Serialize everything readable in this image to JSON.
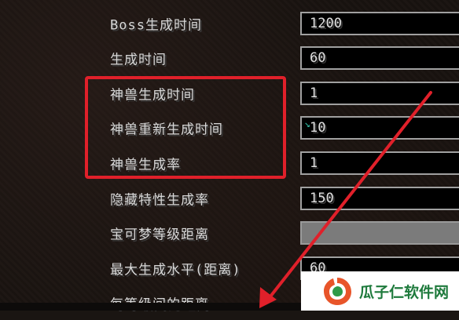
{
  "settings": [
    {
      "label": "Boss生成时间",
      "value": "1200"
    },
    {
      "label": "生成时间",
      "value": "60"
    },
    {
      "label": "神兽生成时间",
      "value": "1"
    },
    {
      "label": "神兽重新生成时间",
      "value": "10"
    },
    {
      "label": "神兽生成率",
      "value": "1"
    },
    {
      "label": "隐藏特性生成率",
      "value": "150"
    },
    {
      "label": "宝可梦等级距离",
      "value": ""
    },
    {
      "label": "最大生成水平(距离)",
      "value": "60"
    },
    {
      "label": "每等级间的距离",
      "value": ""
    }
  ],
  "watermark": {
    "text": "瓜子仁软件网"
  },
  "colors": {
    "highlight": "#e0202a",
    "arrow": "#e0202a",
    "watermark_green": "#1e7a3c"
  }
}
